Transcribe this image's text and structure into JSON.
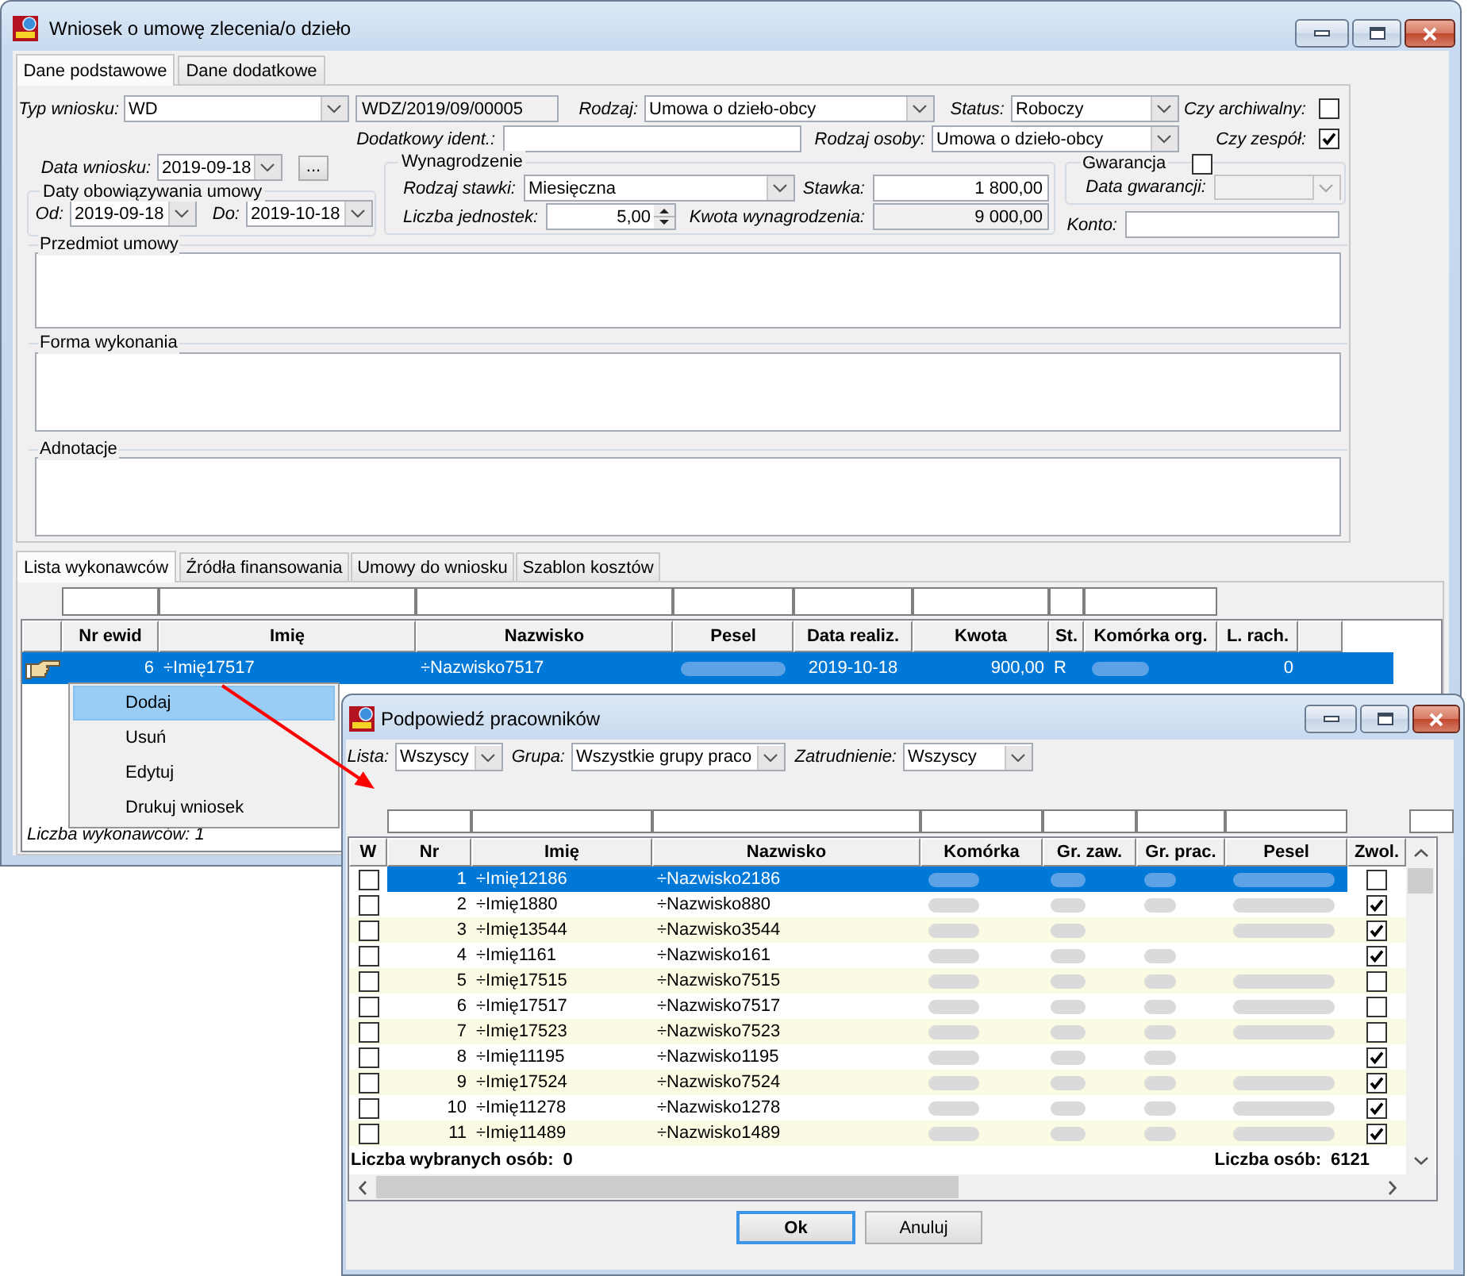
{
  "window": {
    "title": "Wniosek o umowę zlecenia/o dzieło"
  },
  "tabs": [
    {
      "label": "Dane podstawowe",
      "selected": true
    },
    {
      "label": "Dane dodatkowe",
      "selected": false
    }
  ],
  "form": {
    "request_type": {
      "label": "Typ wniosku:",
      "value": "WD"
    },
    "number": {
      "value": "WDZ/2019/09/00005",
      "read_only": true
    },
    "contract_type": {
      "label": "Rodzaj:",
      "value": "Umowa o dzieło-obcy"
    },
    "status": {
      "label": "Status:",
      "value": "Roboczy"
    },
    "archived": {
      "label": "Czy archiwalny:",
      "checked": false
    },
    "extra_id": {
      "label": "Dodatkowy ident.:"
    },
    "person_type": {
      "label": "Rodzaj osoby:",
      "value": "Umowa o dzieło-obcy"
    },
    "team": {
      "label": "Czy zespół:",
      "checked": true
    },
    "request_date": {
      "label": "Data wniosku:",
      "value": "2019-09-18",
      "button": "..."
    },
    "validity": {
      "title": "Daty obowiązywania umowy",
      "from": {
        "label": "Od:",
        "value": "2019-09-18"
      },
      "to": {
        "label": "Do:",
        "value": "2019-10-18"
      }
    },
    "pay": {
      "title": "Wynagrodzenie",
      "rate_type": {
        "label": "Rodzaj stawki:",
        "value": "Miesięczna"
      },
      "rate": {
        "label": "Stawka:",
        "value": "1 800,00",
        "read_only": false
      },
      "units": {
        "label": "Liczba jednostek:",
        "value": "5,00"
      },
      "amount": {
        "label": "Kwota wynagrodzenia:",
        "value": "9 000,00",
        "read_only": true
      }
    },
    "guarantee": {
      "title": "Gwarancja",
      "checked": false,
      "date": {
        "label": "Data gwarancji:",
        "disabled": true
      }
    },
    "account": {
      "label": "Konto:"
    },
    "sections": [
      {
        "label": "Przedmiot umowy"
      },
      {
        "label": "Forma wykonania"
      },
      {
        "label": "Adnotacje"
      }
    ]
  },
  "lower_tabs": [
    {
      "label": "Lista wykonawców",
      "selected": true
    },
    {
      "label": "Źródła finansowania",
      "selected": false
    },
    {
      "label": "Umowy do wniosku",
      "selected": false
    },
    {
      "label": "Szablon kosztów",
      "selected": false
    }
  ],
  "contractors": {
    "columns": [
      {
        "label": "Nr ewid",
        "filter": true
      },
      {
        "label": "Imię",
        "filter": true
      },
      {
        "label": "Nazwisko",
        "filter": true
      },
      {
        "label": "Pesel",
        "filter": true
      },
      {
        "label": "Data realiz.",
        "filter": true
      },
      {
        "label": "Kwota",
        "filter": true
      },
      {
        "label": "St.",
        "filter": true
      },
      {
        "label": "Komórka org.",
        "filter": true
      },
      {
        "label": "L. rach.",
        "filter": false
      }
    ],
    "rows": [
      {
        "selected": true,
        "current": true,
        "cells": [
          {
            "kind": "number",
            "text": "6"
          },
          {
            "kind": "text",
            "text": "÷Imię17517"
          },
          {
            "kind": "text",
            "text": "÷Nazwisko7517"
          },
          {
            "kind": "blur"
          },
          {
            "kind": "date",
            "text": "2019-10-18"
          },
          {
            "kind": "number",
            "text": "900,00"
          },
          {
            "kind": "text",
            "text": "R"
          },
          {
            "kind": "blur"
          },
          {
            "kind": "number",
            "text": "0"
          }
        ]
      }
    ],
    "footer": "Liczba wykonawców: 1"
  },
  "context_menu": {
    "items": [
      {
        "label": "Dodaj",
        "selected": true
      },
      {
        "label": "Usuń",
        "selected": false
      },
      {
        "label": "Edytuj",
        "selected": false
      },
      {
        "label": "Drukuj wniosek",
        "selected": false
      }
    ]
  },
  "dialog": {
    "title": "Podpowiedź pracowników",
    "filters": [
      {
        "label": "Lista:",
        "value": "Wszyscy"
      },
      {
        "label": "Grupa:",
        "value": "Wszystkie grupy praco"
      },
      {
        "label": "Zatrudnienie:",
        "value": "Wszyscy"
      }
    ],
    "grid": {
      "columns": [
        {
          "label": "W",
          "filter": false
        },
        {
          "label": "Nr",
          "filter": true
        },
        {
          "label": "Imię",
          "filter": true
        },
        {
          "label": "Nazwisko",
          "filter": true
        },
        {
          "label": "Komórka",
          "filter": true
        },
        {
          "label": "Gr. zaw.",
          "filter": true
        },
        {
          "label": "Gr. prac.",
          "filter": true
        },
        {
          "label": "Pesel",
          "filter": true
        },
        {
          "label": "Zwol.",
          "filter": false
        }
      ],
      "trailing_filter": true,
      "rows": [
        {
          "selected": true,
          "cells": [
            {
              "kind": "check",
              "checked": false
            },
            {
              "kind": "number",
              "text": "1"
            },
            {
              "kind": "text",
              "text": "÷Imię12186"
            },
            {
              "kind": "text",
              "text": "÷Nazwisko2186"
            },
            {
              "kind": "blur"
            },
            {
              "kind": "blur"
            },
            {
              "kind": "blur"
            },
            {
              "kind": "blur"
            },
            {
              "kind": "check",
              "checked": false
            }
          ]
        },
        {
          "selected": false,
          "cells": [
            {
              "kind": "check",
              "checked": false
            },
            {
              "kind": "number",
              "text": "2"
            },
            {
              "kind": "text",
              "text": "÷Imię1880"
            },
            {
              "kind": "text",
              "text": "÷Nazwisko880"
            },
            {
              "kind": "blur"
            },
            {
              "kind": "blur"
            },
            {
              "kind": "blur"
            },
            {
              "kind": "blur"
            },
            {
              "kind": "check",
              "checked": true
            }
          ]
        },
        {
          "selected": false,
          "cells": [
            {
              "kind": "check",
              "checked": false
            },
            {
              "kind": "number",
              "text": "3"
            },
            {
              "kind": "text",
              "text": "÷Imię13544"
            },
            {
              "kind": "text",
              "text": "÷Nazwisko3544"
            },
            {
              "kind": "blur"
            },
            {
              "kind": "blur"
            },
            {
              "kind": "blank"
            },
            {
              "kind": "blur"
            },
            {
              "kind": "check",
              "checked": true
            }
          ]
        },
        {
          "selected": false,
          "cells": [
            {
              "kind": "check",
              "checked": false
            },
            {
              "kind": "number",
              "text": "4"
            },
            {
              "kind": "text",
              "text": "÷Imię1161"
            },
            {
              "kind": "text",
              "text": "÷Nazwisko161"
            },
            {
              "kind": "blur"
            },
            {
              "kind": "blur"
            },
            {
              "kind": "blur"
            },
            {
              "kind": "blank"
            },
            {
              "kind": "check",
              "checked": true
            }
          ]
        },
        {
          "selected": false,
          "cells": [
            {
              "kind": "check",
              "checked": false
            },
            {
              "kind": "number",
              "text": "5"
            },
            {
              "kind": "text",
              "text": "÷Imię17515"
            },
            {
              "kind": "text",
              "text": "÷Nazwisko7515"
            },
            {
              "kind": "blur"
            },
            {
              "kind": "blur"
            },
            {
              "kind": "blur"
            },
            {
              "kind": "blur"
            },
            {
              "kind": "check",
              "checked": false
            }
          ]
        },
        {
          "selected": false,
          "cells": [
            {
              "kind": "check",
              "checked": false
            },
            {
              "kind": "number",
              "text": "6"
            },
            {
              "kind": "text",
              "text": "÷Imię17517"
            },
            {
              "kind": "text",
              "text": "÷Nazwisko7517"
            },
            {
              "kind": "blur"
            },
            {
              "kind": "blur"
            },
            {
              "kind": "blur"
            },
            {
              "kind": "blur"
            },
            {
              "kind": "check",
              "checked": false
            }
          ]
        },
        {
          "selected": false,
          "cells": [
            {
              "kind": "check",
              "checked": false
            },
            {
              "kind": "number",
              "text": "7"
            },
            {
              "kind": "text",
              "text": "÷Imię17523"
            },
            {
              "kind": "text",
              "text": "÷Nazwisko7523"
            },
            {
              "kind": "blur"
            },
            {
              "kind": "blur"
            },
            {
              "kind": "blur"
            },
            {
              "kind": "blur"
            },
            {
              "kind": "check",
              "checked": false
            }
          ]
        },
        {
          "selected": false,
          "cells": [
            {
              "kind": "check",
              "checked": false
            },
            {
              "kind": "number",
              "text": "8"
            },
            {
              "kind": "text",
              "text": "÷Imię11195"
            },
            {
              "kind": "text",
              "text": "÷Nazwisko1195"
            },
            {
              "kind": "blur"
            },
            {
              "kind": "blur"
            },
            {
              "kind": "blur"
            },
            {
              "kind": "blank"
            },
            {
              "kind": "check",
              "checked": true
            }
          ]
        },
        {
          "selected": false,
          "cells": [
            {
              "kind": "check",
              "checked": false
            },
            {
              "kind": "number",
              "text": "9"
            },
            {
              "kind": "text",
              "text": "÷Imię17524"
            },
            {
              "kind": "text",
              "text": "÷Nazwisko7524"
            },
            {
              "kind": "blur"
            },
            {
              "kind": "blur"
            },
            {
              "kind": "blur"
            },
            {
              "kind": "blur"
            },
            {
              "kind": "check",
              "checked": true
            }
          ]
        },
        {
          "selected": false,
          "cells": [
            {
              "kind": "check",
              "checked": false
            },
            {
              "kind": "number",
              "text": "10"
            },
            {
              "kind": "text",
              "text": "÷Imię11278"
            },
            {
              "kind": "text",
              "text": "÷Nazwisko1278"
            },
            {
              "kind": "blur"
            },
            {
              "kind": "blur"
            },
            {
              "kind": "blur"
            },
            {
              "kind": "blur"
            },
            {
              "kind": "check",
              "checked": true
            }
          ]
        },
        {
          "selected": false,
          "cells": [
            {
              "kind": "check",
              "checked": false
            },
            {
              "kind": "number",
              "text": "11"
            },
            {
              "kind": "text",
              "text": "÷Imię11489"
            },
            {
              "kind": "text",
              "text": "÷Nazwisko1489"
            },
            {
              "kind": "blur"
            },
            {
              "kind": "blur"
            },
            {
              "kind": "blur"
            },
            {
              "kind": "blur"
            },
            {
              "kind": "check",
              "checked": true
            }
          ]
        }
      ]
    },
    "selected_count": {
      "label": "Liczba wybranych osób:",
      "value": "0"
    },
    "total": {
      "label": "Liczba osób:",
      "value": "6121"
    },
    "buttons": [
      {
        "label": "Ok",
        "default": true
      },
      {
        "label": "Anuluj",
        "default": false
      }
    ]
  }
}
